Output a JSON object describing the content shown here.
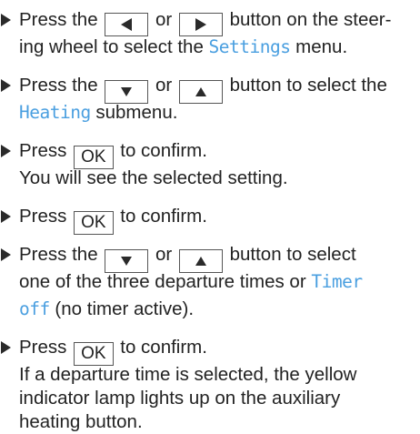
{
  "colors": {
    "text": "#222222",
    "display_text": "#4a9fe0",
    "button_border": "#555555"
  },
  "steps": {
    "s1": {
      "l1a": "Press the ",
      "b1": "left-arrow-button",
      "l1b": " or ",
      "b2": "right-arrow-button",
      "l1c": " button on the steer-",
      "l2a": "ing wheel to select the ",
      "menu": "Settings",
      "l2b": " menu."
    },
    "s2": {
      "l1a": "Press the ",
      "b1": "down-arrow-button",
      "l1b": " or ",
      "b2": "up-arrow-button",
      "l1c": " button to select the",
      "menu": "Heating",
      "l2b": " submenu."
    },
    "s3": {
      "l1a": "Press ",
      "ok": "OK",
      "l1b": " to confirm.",
      "l2": "You will see the selected setting."
    },
    "s4": {
      "l1a": "Press ",
      "ok": "OK",
      "l1b": " to confirm."
    },
    "s5": {
      "l1a": "Press the ",
      "b1": "down-arrow-button",
      "l1b": " or ",
      "b2": "up-arrow-button",
      "l1c": " button to select",
      "l2a": "one of the three departure times or ",
      "menu1": "Timer",
      "menu2": "off",
      "l3b": " (no timer active)."
    },
    "s6": {
      "l1a": "Press ",
      "ok": "OK",
      "l1b": " to confirm.",
      "l2": "If a departure time is selected, the yellow",
      "l3": "indicator lamp lights up on the auxiliary",
      "l4": "heating button."
    }
  }
}
